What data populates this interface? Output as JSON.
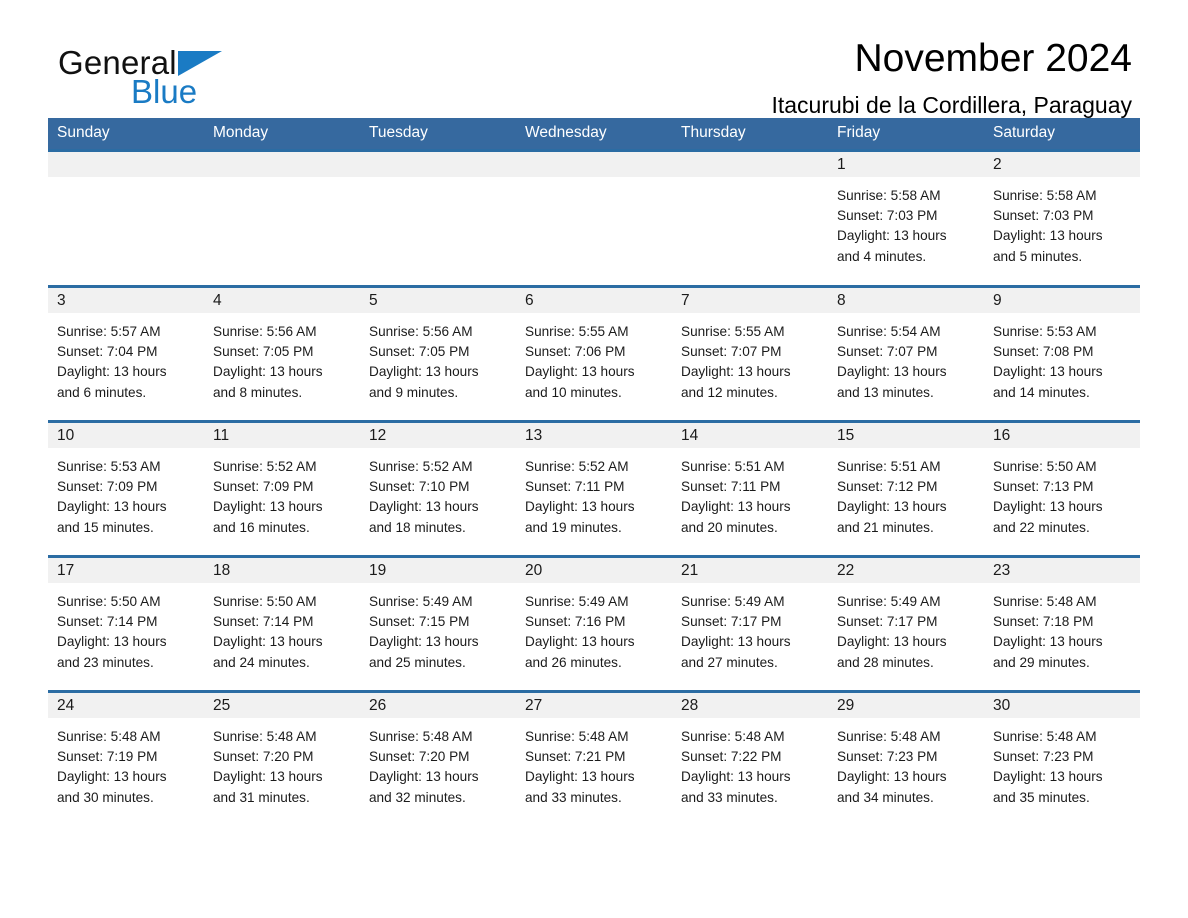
{
  "brand": {
    "name_part1": "General",
    "name_part2": "Blue",
    "logo_icon": "triangle-flag-icon",
    "accent_color": "#1a7bc4"
  },
  "header": {
    "title": "November 2024",
    "subtitle": "Itacurubi de la Cordillera, Paraguay"
  },
  "theme": {
    "header_bg": "#36699f",
    "row_divider": "#2b6ca3",
    "daynum_bg": "#f1f1f1"
  },
  "weekdays": [
    "Sunday",
    "Monday",
    "Tuesday",
    "Wednesday",
    "Thursday",
    "Friday",
    "Saturday"
  ],
  "weeks": [
    [
      {
        "day": "",
        "empty": true
      },
      {
        "day": "",
        "empty": true
      },
      {
        "day": "",
        "empty": true
      },
      {
        "day": "",
        "empty": true
      },
      {
        "day": "",
        "empty": true
      },
      {
        "day": "1",
        "sunrise": "Sunrise: 5:58 AM",
        "sunset": "Sunset: 7:03 PM",
        "daylight1": "Daylight: 13 hours",
        "daylight2": "and 4 minutes."
      },
      {
        "day": "2",
        "sunrise": "Sunrise: 5:58 AM",
        "sunset": "Sunset: 7:03 PM",
        "daylight1": "Daylight: 13 hours",
        "daylight2": "and 5 minutes."
      }
    ],
    [
      {
        "day": "3",
        "sunrise": "Sunrise: 5:57 AM",
        "sunset": "Sunset: 7:04 PM",
        "daylight1": "Daylight: 13 hours",
        "daylight2": "and 6 minutes."
      },
      {
        "day": "4",
        "sunrise": "Sunrise: 5:56 AM",
        "sunset": "Sunset: 7:05 PM",
        "daylight1": "Daylight: 13 hours",
        "daylight2": "and 8 minutes."
      },
      {
        "day": "5",
        "sunrise": "Sunrise: 5:56 AM",
        "sunset": "Sunset: 7:05 PM",
        "daylight1": "Daylight: 13 hours",
        "daylight2": "and 9 minutes."
      },
      {
        "day": "6",
        "sunrise": "Sunrise: 5:55 AM",
        "sunset": "Sunset: 7:06 PM",
        "daylight1": "Daylight: 13 hours",
        "daylight2": "and 10 minutes."
      },
      {
        "day": "7",
        "sunrise": "Sunrise: 5:55 AM",
        "sunset": "Sunset: 7:07 PM",
        "daylight1": "Daylight: 13 hours",
        "daylight2": "and 12 minutes."
      },
      {
        "day": "8",
        "sunrise": "Sunrise: 5:54 AM",
        "sunset": "Sunset: 7:07 PM",
        "daylight1": "Daylight: 13 hours",
        "daylight2": "and 13 minutes."
      },
      {
        "day": "9",
        "sunrise": "Sunrise: 5:53 AM",
        "sunset": "Sunset: 7:08 PM",
        "daylight1": "Daylight: 13 hours",
        "daylight2": "and 14 minutes."
      }
    ],
    [
      {
        "day": "10",
        "sunrise": "Sunrise: 5:53 AM",
        "sunset": "Sunset: 7:09 PM",
        "daylight1": "Daylight: 13 hours",
        "daylight2": "and 15 minutes."
      },
      {
        "day": "11",
        "sunrise": "Sunrise: 5:52 AM",
        "sunset": "Sunset: 7:09 PM",
        "daylight1": "Daylight: 13 hours",
        "daylight2": "and 16 minutes."
      },
      {
        "day": "12",
        "sunrise": "Sunrise: 5:52 AM",
        "sunset": "Sunset: 7:10 PM",
        "daylight1": "Daylight: 13 hours",
        "daylight2": "and 18 minutes."
      },
      {
        "day": "13",
        "sunrise": "Sunrise: 5:52 AM",
        "sunset": "Sunset: 7:11 PM",
        "daylight1": "Daylight: 13 hours",
        "daylight2": "and 19 minutes."
      },
      {
        "day": "14",
        "sunrise": "Sunrise: 5:51 AM",
        "sunset": "Sunset: 7:11 PM",
        "daylight1": "Daylight: 13 hours",
        "daylight2": "and 20 minutes."
      },
      {
        "day": "15",
        "sunrise": "Sunrise: 5:51 AM",
        "sunset": "Sunset: 7:12 PM",
        "daylight1": "Daylight: 13 hours",
        "daylight2": "and 21 minutes."
      },
      {
        "day": "16",
        "sunrise": "Sunrise: 5:50 AM",
        "sunset": "Sunset: 7:13 PM",
        "daylight1": "Daylight: 13 hours",
        "daylight2": "and 22 minutes."
      }
    ],
    [
      {
        "day": "17",
        "sunrise": "Sunrise: 5:50 AM",
        "sunset": "Sunset: 7:14 PM",
        "daylight1": "Daylight: 13 hours",
        "daylight2": "and 23 minutes."
      },
      {
        "day": "18",
        "sunrise": "Sunrise: 5:50 AM",
        "sunset": "Sunset: 7:14 PM",
        "daylight1": "Daylight: 13 hours",
        "daylight2": "and 24 minutes."
      },
      {
        "day": "19",
        "sunrise": "Sunrise: 5:49 AM",
        "sunset": "Sunset: 7:15 PM",
        "daylight1": "Daylight: 13 hours",
        "daylight2": "and 25 minutes."
      },
      {
        "day": "20",
        "sunrise": "Sunrise: 5:49 AM",
        "sunset": "Sunset: 7:16 PM",
        "daylight1": "Daylight: 13 hours",
        "daylight2": "and 26 minutes."
      },
      {
        "day": "21",
        "sunrise": "Sunrise: 5:49 AM",
        "sunset": "Sunset: 7:17 PM",
        "daylight1": "Daylight: 13 hours",
        "daylight2": "and 27 minutes."
      },
      {
        "day": "22",
        "sunrise": "Sunrise: 5:49 AM",
        "sunset": "Sunset: 7:17 PM",
        "daylight1": "Daylight: 13 hours",
        "daylight2": "and 28 minutes."
      },
      {
        "day": "23",
        "sunrise": "Sunrise: 5:48 AM",
        "sunset": "Sunset: 7:18 PM",
        "daylight1": "Daylight: 13 hours",
        "daylight2": "and 29 minutes."
      }
    ],
    [
      {
        "day": "24",
        "sunrise": "Sunrise: 5:48 AM",
        "sunset": "Sunset: 7:19 PM",
        "daylight1": "Daylight: 13 hours",
        "daylight2": "and 30 minutes."
      },
      {
        "day": "25",
        "sunrise": "Sunrise: 5:48 AM",
        "sunset": "Sunset: 7:20 PM",
        "daylight1": "Daylight: 13 hours",
        "daylight2": "and 31 minutes."
      },
      {
        "day": "26",
        "sunrise": "Sunrise: 5:48 AM",
        "sunset": "Sunset: 7:20 PM",
        "daylight1": "Daylight: 13 hours",
        "daylight2": "and 32 minutes."
      },
      {
        "day": "27",
        "sunrise": "Sunrise: 5:48 AM",
        "sunset": "Sunset: 7:21 PM",
        "daylight1": "Daylight: 13 hours",
        "daylight2": "and 33 minutes."
      },
      {
        "day": "28",
        "sunrise": "Sunrise: 5:48 AM",
        "sunset": "Sunset: 7:22 PM",
        "daylight1": "Daylight: 13 hours",
        "daylight2": "and 33 minutes."
      },
      {
        "day": "29",
        "sunrise": "Sunrise: 5:48 AM",
        "sunset": "Sunset: 7:23 PM",
        "daylight1": "Daylight: 13 hours",
        "daylight2": "and 34 minutes."
      },
      {
        "day": "30",
        "sunrise": "Sunrise: 5:48 AM",
        "sunset": "Sunset: 7:23 PM",
        "daylight1": "Daylight: 13 hours",
        "daylight2": "and 35 minutes."
      }
    ]
  ]
}
